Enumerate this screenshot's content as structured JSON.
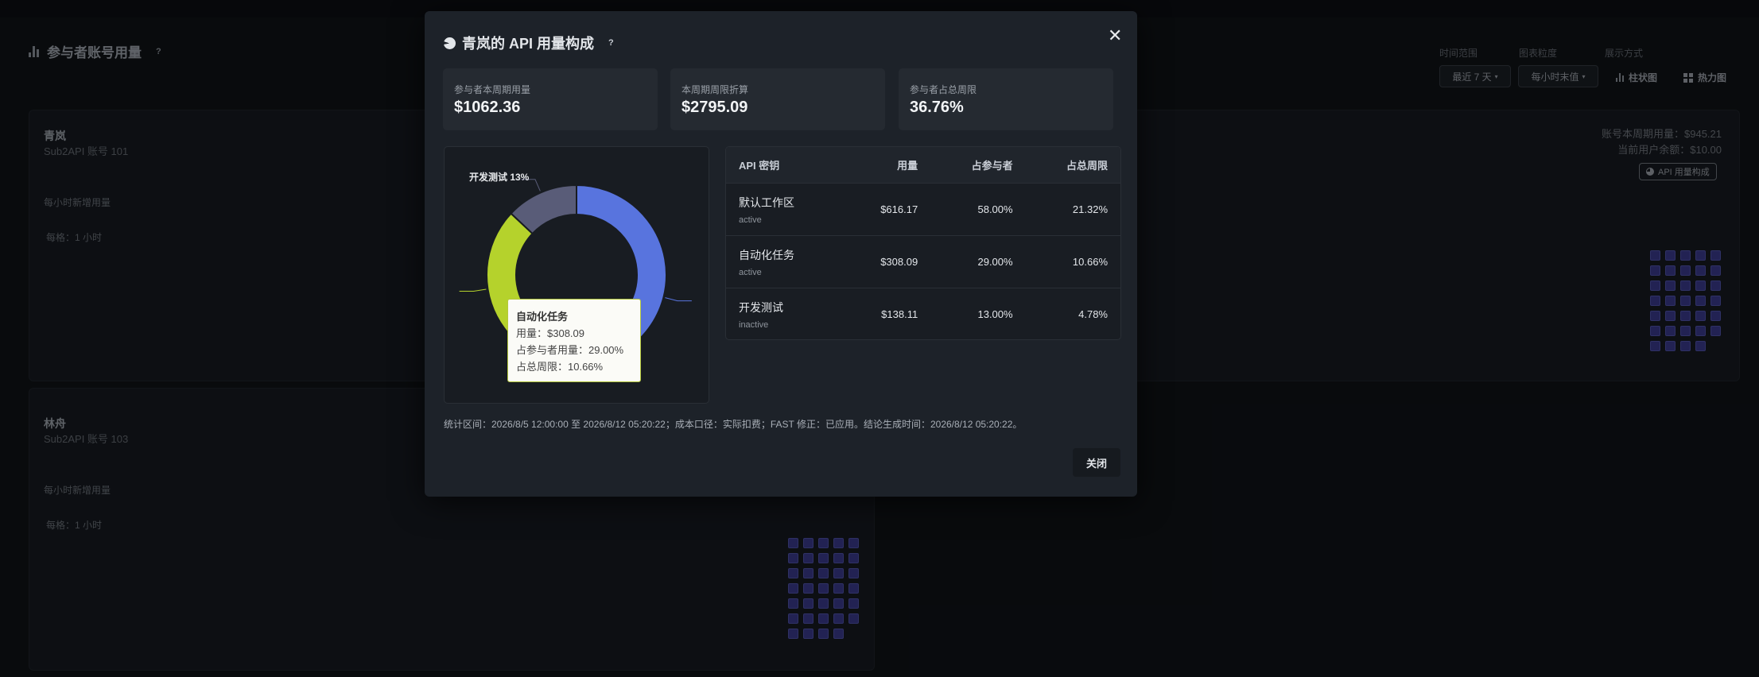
{
  "background": {
    "page_title": "参与者账号用量",
    "help_mark": "?",
    "controls": {
      "time_range_label": "时间范围",
      "time_range_value": "最近 7 天",
      "granularity_label": "图表粒度",
      "granularity_value": "每小时末值",
      "display_label": "展示方式",
      "view_bar": "柱状图",
      "view_heatmap": "热力图"
    },
    "accounts": [
      {
        "name": "青岚",
        "sub": "Sub2API 账号 101",
        "section_label": "每小时新增用量",
        "scale_label": "每格：1 小时",
        "period_usage": "账号本周期用量：$945.21",
        "balance": "当前用户余额：$10.00",
        "composition_button": "API 用量构成"
      },
      {
        "name": "林舟",
        "sub": "Sub2API 账号 103",
        "section_label": "每小时新增用量",
        "scale_label": "每格：1 小时"
      }
    ]
  },
  "modal": {
    "title": "青岚的 API 用量构成",
    "help_mark": "?",
    "close_icon": "close-icon",
    "kpis": [
      {
        "label": "参与者本周期用量",
        "value": "$1062.36"
      },
      {
        "label": "本周期周限折算",
        "value": "$2795.09"
      },
      {
        "label": "参与者占总周限",
        "value": "36.76%"
      }
    ],
    "chart_data": {
      "type": "pie",
      "variant": "donut",
      "categories": [
        "默认工作区",
        "自动化任务",
        "开发测试"
      ],
      "values": [
        616.17,
        308.09,
        138.11
      ],
      "colors": [
        "#5874de",
        "#b5d22c",
        "#595c78"
      ],
      "outside_label": "开发测试 13%"
    },
    "tooltip": {
      "title": "自动化任务",
      "line1": "用量：$308.09",
      "line2": "占参与者用量：29.00%",
      "line3": "占总周限：10.66%"
    },
    "table": {
      "headers": [
        "API 密钥",
        "用量",
        "占参与者",
        "占总周限"
      ],
      "rows": [
        {
          "name": "默认工作区",
          "status": "active",
          "usage": "$616.17",
          "pct_participant": "58.00%",
          "pct_total": "21.32%"
        },
        {
          "name": "自动化任务",
          "status": "active",
          "usage": "$308.09",
          "pct_participant": "29.00%",
          "pct_total": "10.66%"
        },
        {
          "name": "开发测试",
          "status": "inactive",
          "usage": "$138.11",
          "pct_participant": "13.00%",
          "pct_total": "4.78%"
        }
      ]
    },
    "footnote": "统计区间：2026/8/5 12:00:00 至 2026/8/12 05:20:22；成本口径：实际扣费；FAST 修正：已应用。结论生成时间：2026/8/12 05:20:22。",
    "close_button": "关闭"
  }
}
